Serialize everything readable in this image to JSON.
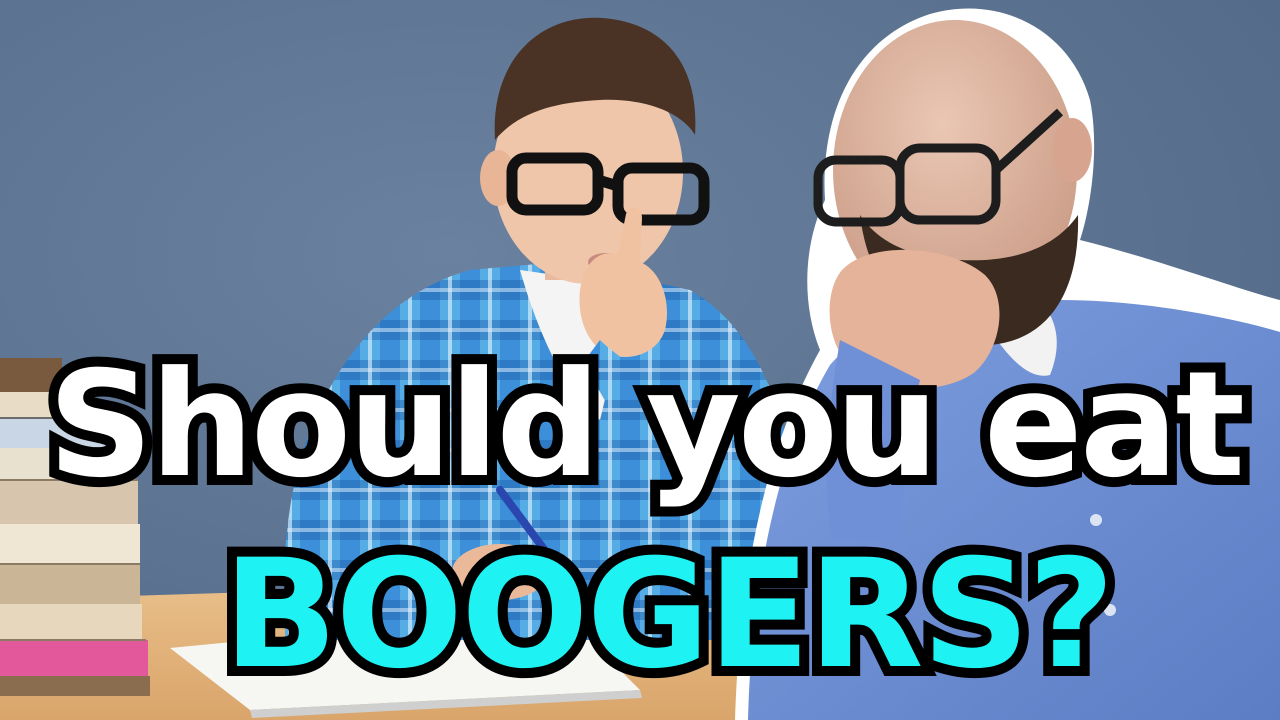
{
  "thumbnail": {
    "headline_line1": "Should you eat",
    "headline_line2": "BOOGERS?",
    "colors": {
      "background_wall": "#5b7391",
      "headline_line1_fill": "#ffffff",
      "headline_line2_fill": "#1ef2f2",
      "text_outline": "#000000",
      "desk": "#e3b57e",
      "kid_shirt": "#3e8fd6",
      "man_shirt": "#6f90d6",
      "man_outline_glow": "#ffffff"
    }
  }
}
